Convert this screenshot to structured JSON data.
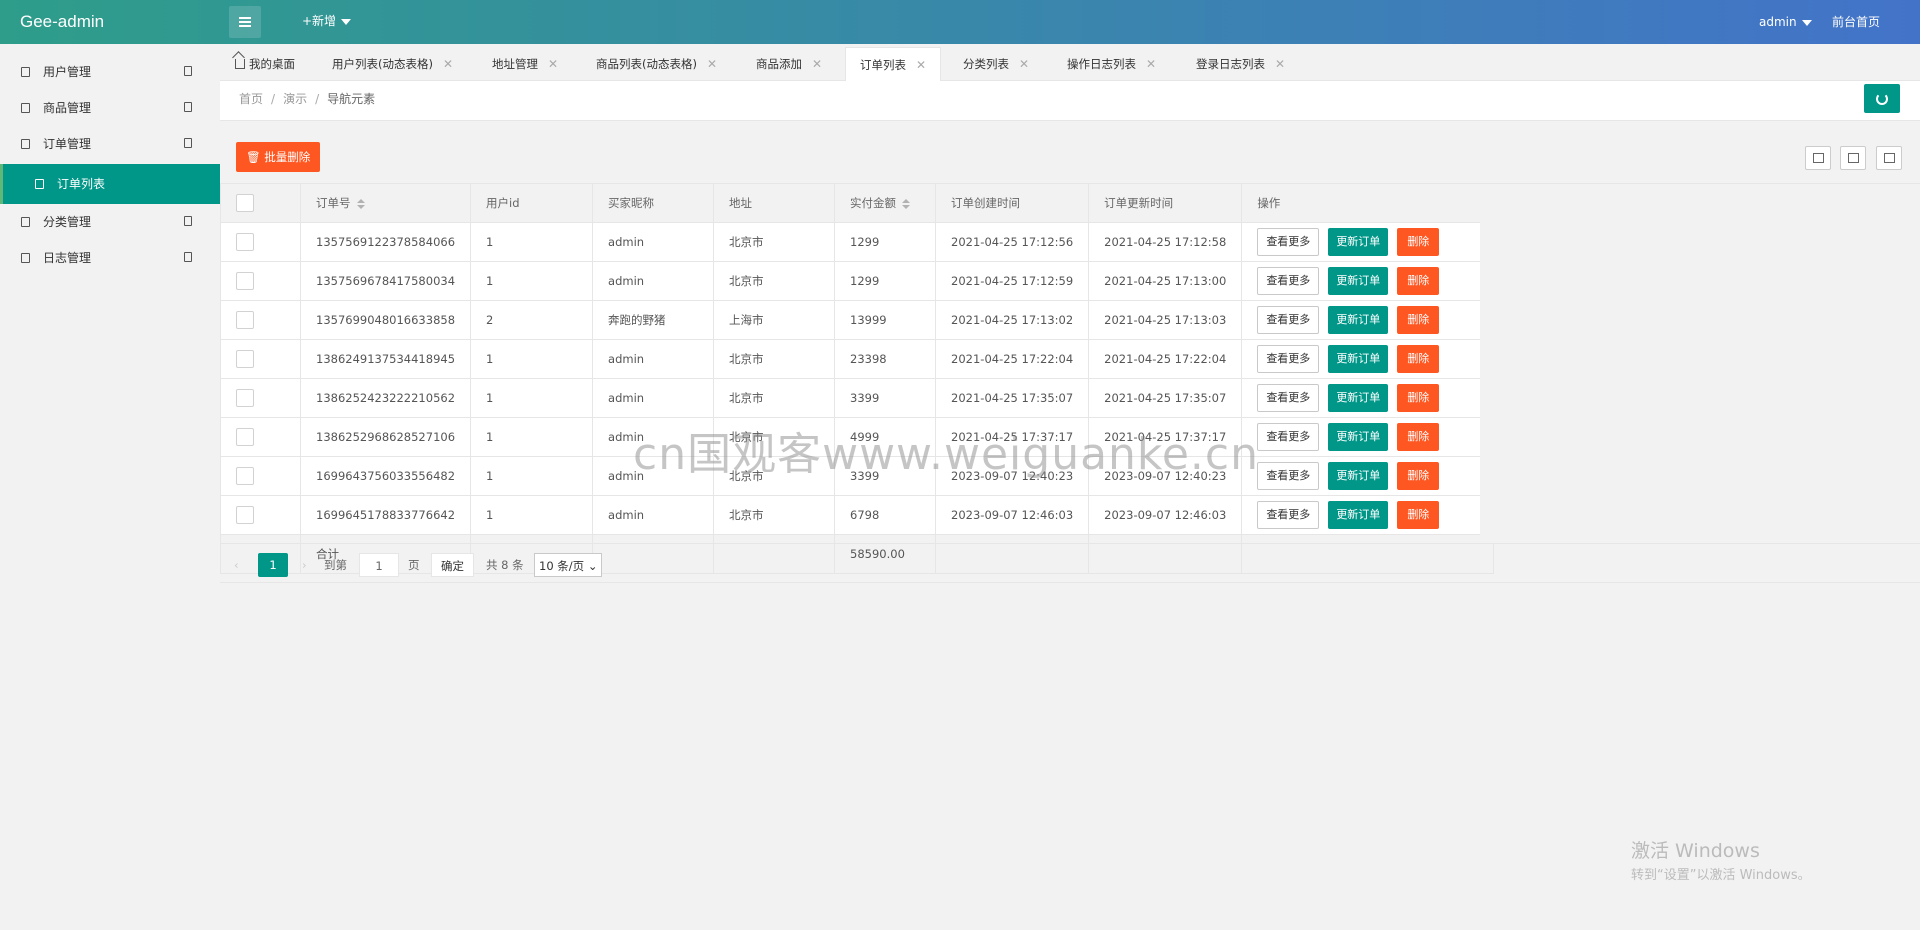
{
  "header": {
    "logo": "Gee-admin",
    "add_label": "+新增",
    "user_label": "admin",
    "front_link": "前台首页"
  },
  "sidebar": {
    "items": [
      {
        "label": "用户管理"
      },
      {
        "label": "商品管理"
      },
      {
        "label": "订单管理"
      },
      {
        "label": "订单列表",
        "active": true
      },
      {
        "label": "分类管理"
      },
      {
        "label": "日志管理"
      }
    ]
  },
  "tabs": [
    {
      "label": "我的桌面"
    },
    {
      "label": "用户列表(动态表格)"
    },
    {
      "label": "地址管理"
    },
    {
      "label": "商品列表(动态表格)"
    },
    {
      "label": "商品添加"
    },
    {
      "label": "订单列表"
    },
    {
      "label": "分类列表"
    },
    {
      "label": "操作日志列表"
    },
    {
      "label": "登录日志列表"
    }
  ],
  "breadcrumb": [
    "首页",
    "演示",
    "导航元素"
  ],
  "toolbar": {
    "batch_delete": "批量删除"
  },
  "table": {
    "headers": [
      "订单号",
      "用户id",
      "买家昵称",
      "地址",
      "实付金额",
      "订单创建时间",
      "订单更新时间",
      "操作"
    ],
    "rows": [
      [
        "1357569122378584066",
        "1",
        "admin",
        "北京市",
        "1299",
        "2021-04-25 17:12:56",
        "2021-04-25 17:12:58"
      ],
      [
        "1357569678417580034",
        "1",
        "admin",
        "北京市",
        "1299",
        "2021-04-25 17:12:59",
        "2021-04-25 17:13:00"
      ],
      [
        "1357699048016633858",
        "2",
        "奔跑的野猪",
        "上海市",
        "13999",
        "2021-04-25 17:13:02",
        "2021-04-25 17:13:03"
      ],
      [
        "1386249137534418945",
        "1",
        "admin",
        "北京市",
        "23398",
        "2021-04-25 17:22:04",
        "2021-04-25 17:22:04"
      ],
      [
        "1386252423222210562",
        "1",
        "admin",
        "北京市",
        "3399",
        "2021-04-25 17:35:07",
        "2021-04-25 17:35:07"
      ],
      [
        "1386252968628527106",
        "1",
        "admin",
        "北京市",
        "4999",
        "2021-04-25 17:37:17",
        "2021-04-25 17:37:17"
      ],
      [
        "1699643756033556482",
        "1",
        "admin",
        "北京市",
        "3399",
        "2023-09-07 12:40:23",
        "2023-09-07 12:40:23"
      ],
      [
        "1699645178833776642",
        "1",
        "admin",
        "北京市",
        "6798",
        "2023-09-07 12:46:03",
        "2023-09-07 12:46:03"
      ]
    ],
    "actions": {
      "more": "查看更多",
      "update": "更新订单",
      "delete": "删除"
    },
    "summary": {
      "label": "合计",
      "total": "58590.00"
    }
  },
  "pager": {
    "current": "1",
    "goto_label": "到第",
    "goto_value": "1",
    "page_unit": "页",
    "confirm": "确定",
    "total": "共 8 条",
    "per_page": "10 条/页"
  },
  "watermark": "cn国观客www.weiguanke.cn",
  "windows_activation": {
    "title": "激活 Windows",
    "subtitle": "转到“设置”以激活 Windows。"
  }
}
